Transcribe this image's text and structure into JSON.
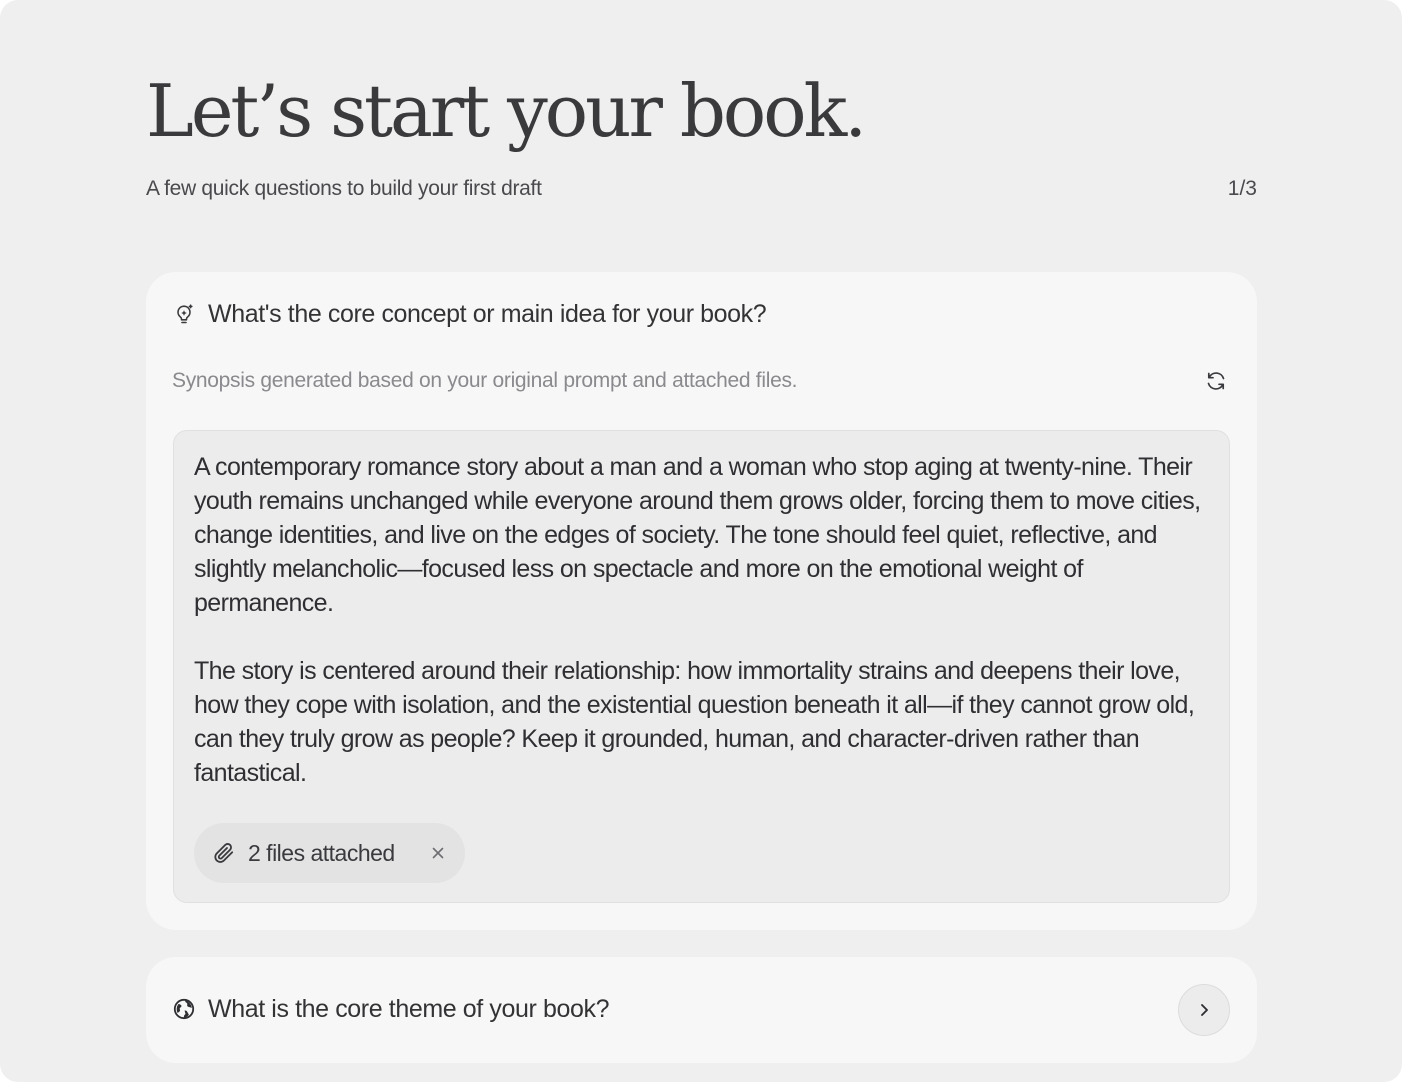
{
  "header": {
    "title": "Let’s start your book.",
    "subtitle": "A few quick questions to build your first draft",
    "progress": "1/3"
  },
  "questions": [
    {
      "icon": "lightbulb-sparkle-icon",
      "text": "What's the core concept or main idea for your book?",
      "expanded": true,
      "hint": "Synopsis generated based on your original prompt and attached files.",
      "refresh_icon": "refresh-icon",
      "synopsis": [
        "A contemporary romance story about a man and a woman who stop aging at twenty-nine. Their youth remains unchanged while everyone around them grows older, forcing them to move cities, change identities, and live on the edges of society. The tone should feel quiet, reflective, and slightly melancholic—focused less on spectacle and more on the emotional weight of permanence.",
        "The story is centered around their relationship: how immortality strains and deepens their love, how they cope with isolation, and the existential question beneath it all—if they cannot grow old, can they truly grow as people? Keep it grounded, human, and character-driven rather than fantastical."
      ],
      "attachments": {
        "icon": "paperclip-icon",
        "label": "2 files attached",
        "remove_icon": "close-icon"
      }
    },
    {
      "icon": "globe-icon",
      "text": "What is the core theme of your book?",
      "expanded": false,
      "next_icon": "chevron-right-icon"
    }
  ]
}
